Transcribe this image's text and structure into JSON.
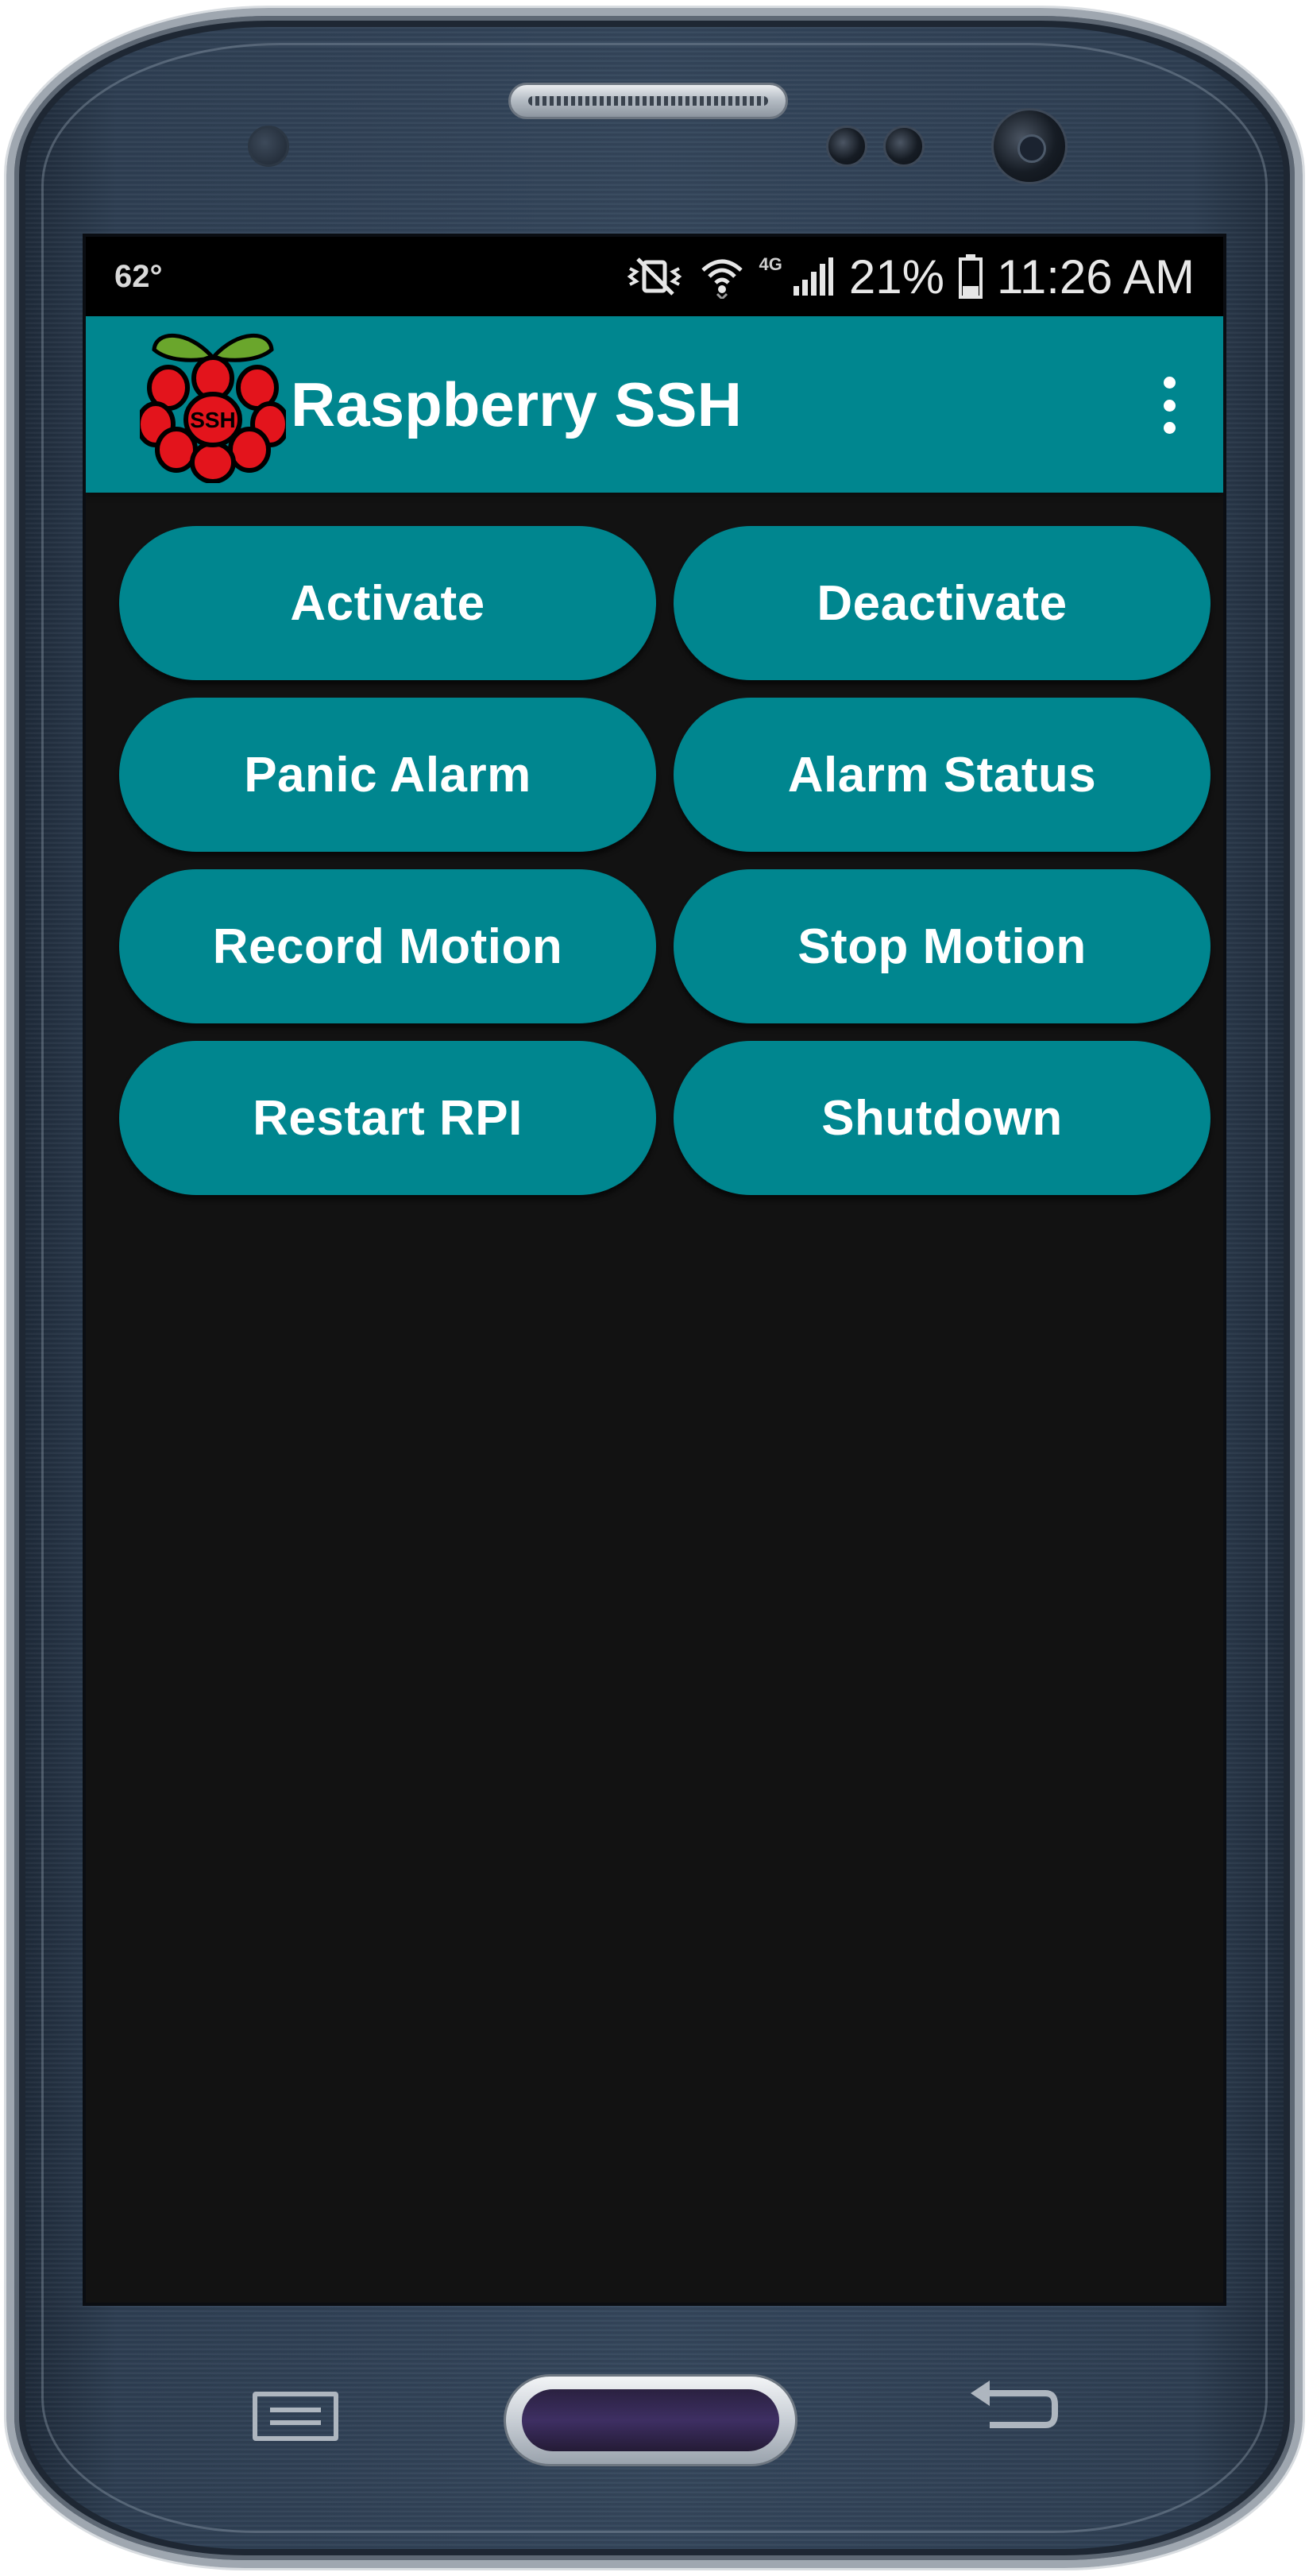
{
  "status_bar": {
    "temperature": "62°",
    "battery": "21%",
    "time": "11:26 AM",
    "network": "4G",
    "icons": [
      "vibrate-mute-icon",
      "wifi-icon",
      "signal-icon",
      "battery-icon"
    ]
  },
  "app_bar": {
    "title": "Raspberry SSH",
    "logo_text": "SSH",
    "overflow_icon": "overflow-menu-icon"
  },
  "buttons": [
    {
      "label": "Activate"
    },
    {
      "label": "Deactivate"
    },
    {
      "label": "Panic Alarm"
    },
    {
      "label": "Alarm Status"
    },
    {
      "label": "Record Motion"
    },
    {
      "label": "Stop Motion"
    },
    {
      "label": "Restart RPI"
    },
    {
      "label": "Shutdown"
    }
  ],
  "colors": {
    "primary": "#00868f",
    "screen_background": "#121212",
    "status_bar": "#000000",
    "button_text": "#ffffff"
  },
  "hardware_keys": [
    "menu-key-icon",
    "home-button",
    "back-key-icon"
  ]
}
